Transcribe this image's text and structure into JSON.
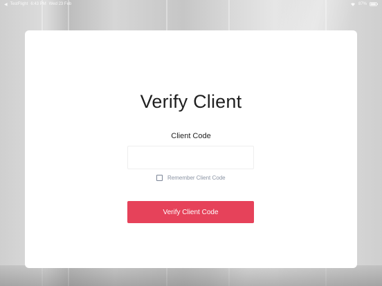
{
  "status_bar": {
    "app": "TestFlight",
    "time": "6:43 PM",
    "date": "Wed 23 Feb",
    "battery": "87%"
  },
  "form": {
    "title": "Verify Client",
    "field_label": "Client Code",
    "input_value": "",
    "input_placeholder": "",
    "remember_label": "Remember Client Code",
    "remember_checked": false,
    "submit_label": "Verify Client Code"
  },
  "colors": {
    "accent": "#e6425a",
    "card": "#ffffff",
    "title_text": "#1f1f1f",
    "muted_text": "#8a93a3"
  }
}
